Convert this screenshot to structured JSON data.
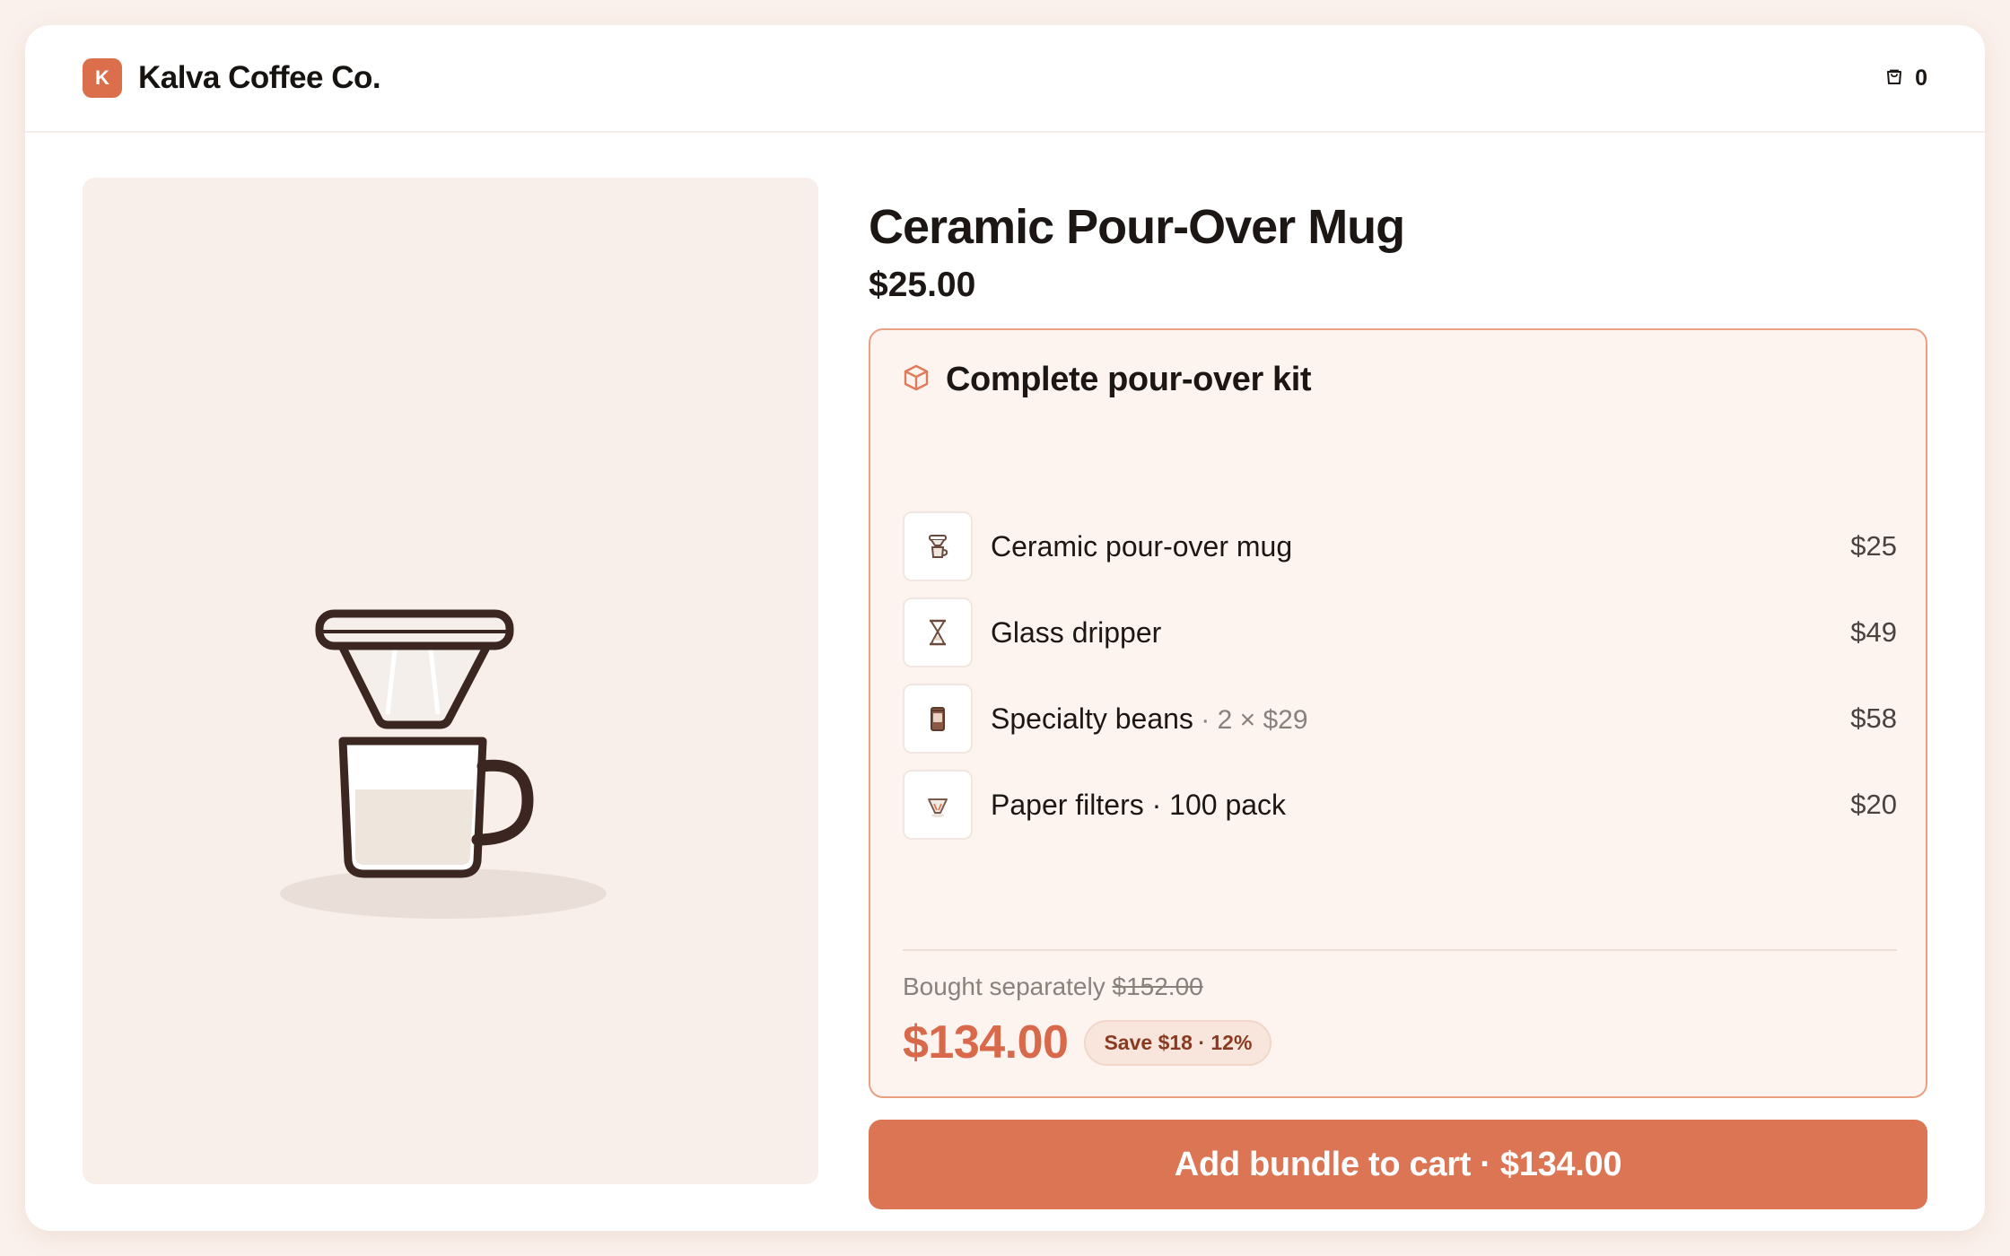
{
  "header": {
    "logo_letter": "K",
    "brand": "Kalva Coffee Co.",
    "cart_count": "0"
  },
  "product": {
    "title": "Ceramic Pour-Over Mug",
    "price": "$25.00"
  },
  "bundle": {
    "title": "Complete pour-over kit",
    "items": [
      {
        "name": "Ceramic pour-over mug",
        "detail": "",
        "price": "$25",
        "icon": "pour-over-mug-icon"
      },
      {
        "name": "Glass dripper",
        "detail": "",
        "price": "$49",
        "icon": "glass-dripper-icon"
      },
      {
        "name": "Specialty beans",
        "detail": " · 2 × $29",
        "price": "$58",
        "icon": "coffee-bag-icon"
      },
      {
        "name": "Paper filters · 100 pack",
        "detail": "",
        "price": "$20",
        "icon": "paper-filter-icon"
      }
    ],
    "separately_label": "Bought separately",
    "separately_price": "$152.00",
    "bundle_price": "$134.00",
    "save_badge": "Save $18 · 12%"
  },
  "cta": {
    "label": "Add bundle to cart · $134.00"
  },
  "colors": {
    "accent": "#db6f4c",
    "accent_text": "#d8694a",
    "panel_bg": "#f9efea",
    "bundle_bg": "#fdf4f0",
    "bundle_border": "#e9a083"
  }
}
